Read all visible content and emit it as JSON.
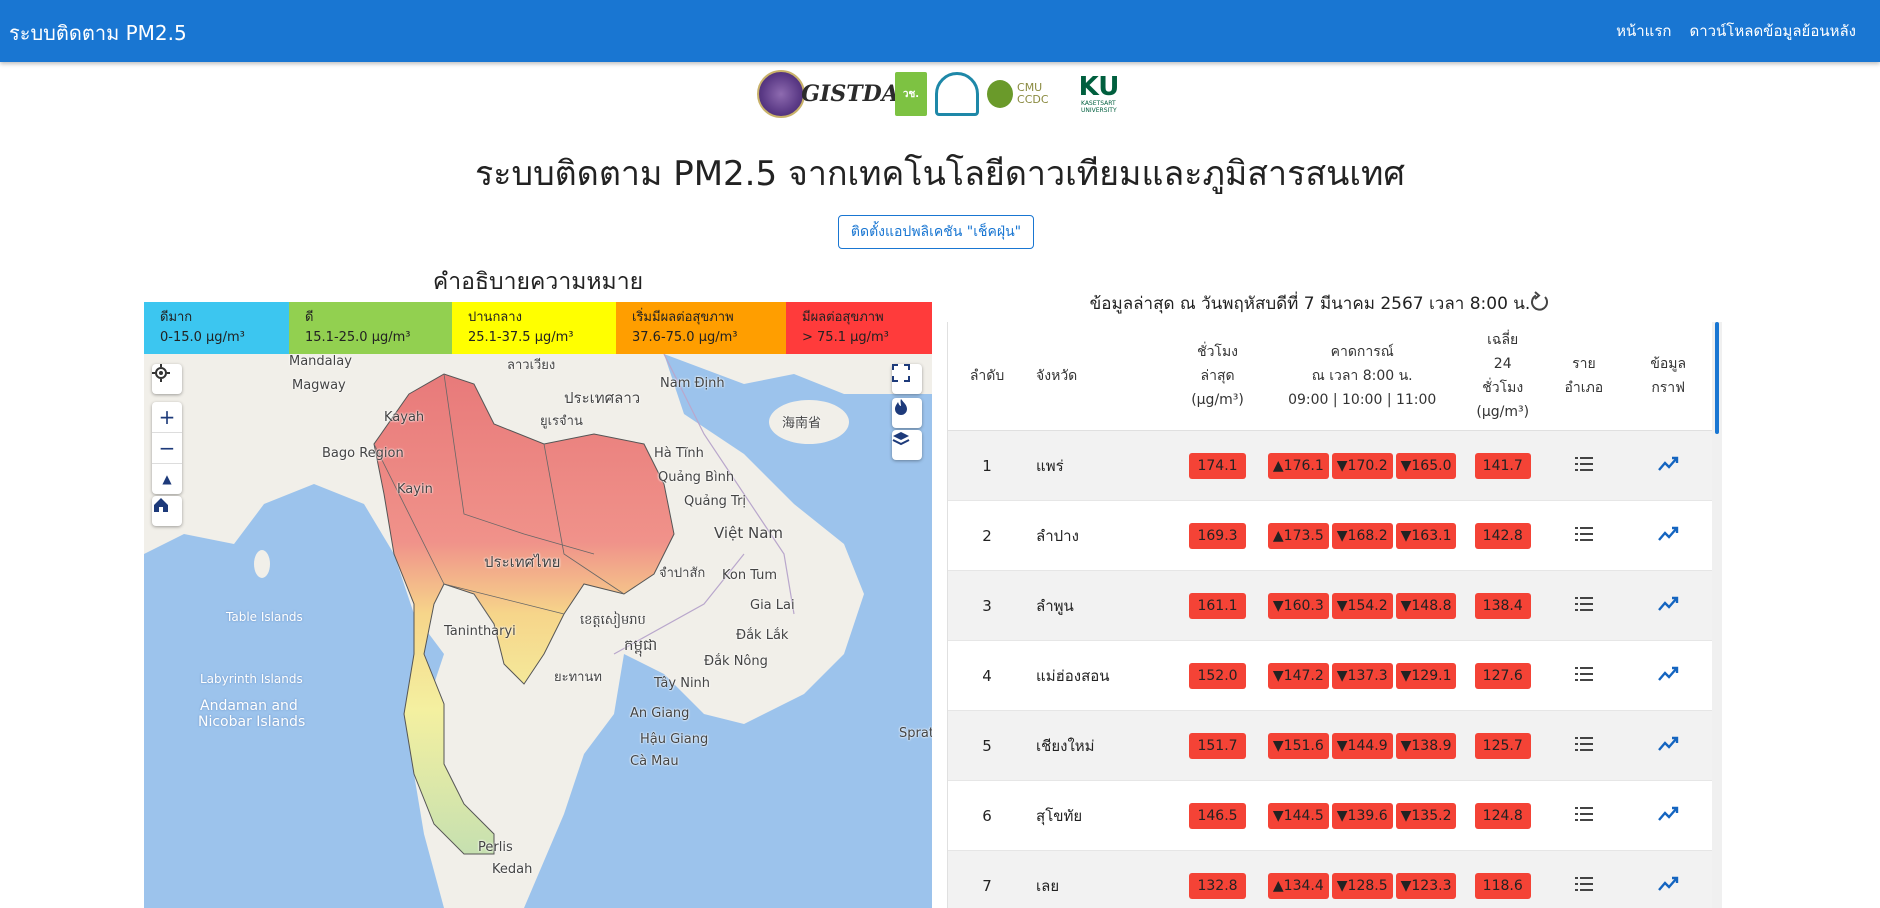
{
  "nav": {
    "brand": "ระบบติดตาม PM2.5",
    "links": [
      "หน้าแรก",
      "ดาวน์โหลดข้อมูลย้อนหลัง"
    ]
  },
  "logos": {
    "gistda": "GISTDA",
    "nrct": "วช.",
    "cmu": "CMU CCDC",
    "ku": "KU",
    "ku_sub": "KASETSART UNIVERSITY"
  },
  "title": "ระบบติดตาม PM2.5 จากเทคโนโลยีดาวเทียมและภูมิสารสนเทศ",
  "install_button": "ติดตั้งแอปพลิเคชัน \"เช็คฝุ่น\"",
  "legend": {
    "title": "คำอธิบายความหมาย",
    "levels": [
      {
        "label": "ดีมาก",
        "range": "0-15.0 µg/m³",
        "color": "#3cc6f0"
      },
      {
        "label": "ดี",
        "range": "15.1-25.0 µg/m³",
        "color": "#92d050"
      },
      {
        "label": "ปานกลาง",
        "range": "25.1-37.5 µg/m³",
        "color": "#ffff00"
      },
      {
        "label": "เริ่มมีผลต่อสุขภาพ",
        "range": "37.6-75.0 µg/m³",
        "color": "#ff9e00"
      },
      {
        "label": "มีผลต่อสุขภาพ",
        "range": "> 75.1 µg/m³",
        "color": "#ff3b3b"
      }
    ]
  },
  "map": {
    "labels": [
      "Mandalay",
      "Magway",
      "Kayah",
      "Bago Region",
      "Kayin",
      "ประเทศลาว",
      "Nam Định",
      "Hà Tĩnh",
      "Quảng Bình",
      "Quảng Trị",
      "Việt Nam",
      "ประเทศไทย",
      "Kon Tum",
      "Gia Lai",
      "Tanintharyi",
      "ខេត្តសៀមរាប",
      "កម្ពុជា",
      "Đắk Lắk",
      "Đắk Nông",
      "Tây Ninh",
      "An Giang",
      "Hậu Giang",
      "Cà Mau",
      "Table Islands",
      "Labyrinth Islands",
      "Andaman and",
      "Nicobar Islands",
      "Perlis",
      "Kedah",
      "海南省",
      "Sprat",
      "ลาวเวียง",
      "ยูเรจำน",
      "จำปาสัก",
      "ยะทานท"
    ]
  },
  "updated": "ข้อมูลล่าสุด ณ วันพฤหัสบดีที่ 7 มีนาคม 2567 เวลา 8:00 น.",
  "table": {
    "headers": {
      "rank": "ลำดับ",
      "province": "จังหวัด",
      "hourly": [
        "ชั่วโมง",
        "ล่าสุด",
        "(µg/m³)"
      ],
      "forecast": [
        "คาดการณ์",
        "ณ เวลา 8:00 น.",
        "09:00 | 10:00 | 11:00"
      ],
      "avg": [
        "เฉลี่ย",
        "24",
        "ชั่วโมง",
        "(µg/m³)"
      ],
      "district": [
        "ราย",
        "อำเภอ"
      ],
      "graph": [
        "ข้อมูล",
        "กราฟ"
      ]
    },
    "rows": [
      {
        "rank": "1",
        "province": "แพร่",
        "hourly": "174.1",
        "f1": "▲176.1",
        "f2": "▼170.2",
        "f3": "▼165.0",
        "avg": "141.7"
      },
      {
        "rank": "2",
        "province": "ลำปาง",
        "hourly": "169.3",
        "f1": "▲173.5",
        "f2": "▼168.2",
        "f3": "▼163.1",
        "avg": "142.8"
      },
      {
        "rank": "3",
        "province": "ลำพูน",
        "hourly": "161.1",
        "f1": "▼160.3",
        "f2": "▼154.2",
        "f3": "▼148.8",
        "avg": "138.4"
      },
      {
        "rank": "4",
        "province": "แม่ฮ่องสอน",
        "hourly": "152.0",
        "f1": "▼147.2",
        "f2": "▼137.3",
        "f3": "▼129.1",
        "avg": "127.6"
      },
      {
        "rank": "5",
        "province": "เชียงใหม่",
        "hourly": "151.7",
        "f1": "▼151.6",
        "f2": "▼144.9",
        "f3": "▼138.9",
        "avg": "125.7"
      },
      {
        "rank": "6",
        "province": "สุโขทัย",
        "hourly": "146.5",
        "f1": "▼144.5",
        "f2": "▼139.6",
        "f3": "▼135.2",
        "avg": "124.8"
      },
      {
        "rank": "7",
        "province": "เลย",
        "hourly": "132.8",
        "f1": "▲134.4",
        "f2": "▼128.5",
        "f3": "▼123.3",
        "avg": "118.6"
      }
    ]
  },
  "colors": {
    "primary": "#1976d2",
    "unhealthy": "#f44336",
    "water": "#9cc3ec",
    "land": "#f1efe9"
  }
}
